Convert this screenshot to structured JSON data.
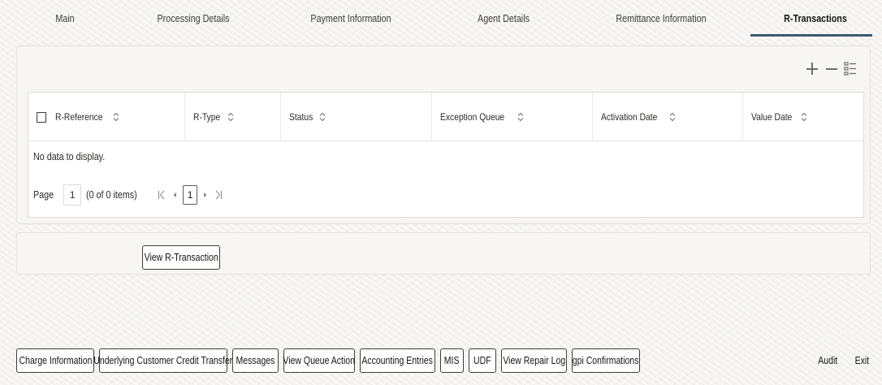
{
  "tabs": [
    {
      "label": "Main",
      "active": false
    },
    {
      "label": "Processing Details",
      "active": false
    },
    {
      "label": "Payment Information",
      "active": false
    },
    {
      "label": "Agent Details",
      "active": false
    },
    {
      "label": "Remittance Information",
      "active": false
    },
    {
      "label": "R-Transactions",
      "active": true
    }
  ],
  "toolbar": {
    "add_icon": "plus-icon",
    "remove_icon": "minus-icon",
    "columns_icon": "column-list-icon"
  },
  "grid": {
    "columns": [
      "R-Reference",
      "R-Type",
      "Status",
      "Exception Queue",
      "Activation Date",
      "Value Date"
    ],
    "empty_message": "No data to display.",
    "pager": {
      "page_label": "Page",
      "current_page": "1",
      "items_text": "(0 of 0 items)",
      "page_number": "1"
    }
  },
  "actions": {
    "view_r_transaction": "View R-Transaction"
  },
  "footer": {
    "buttons": [
      "Charge Information",
      "Underlying Customer Credit Transfer",
      "Messages",
      "View Queue Action",
      "Accounting Entries",
      "MIS",
      "UDF",
      "View Repair Log",
      "gpi Confirmations"
    ],
    "audit": "Audit",
    "exit": "Exit"
  },
  "colors": {
    "active_tab_underline": "#3a5a6e",
    "background": "#f4f3f1"
  }
}
